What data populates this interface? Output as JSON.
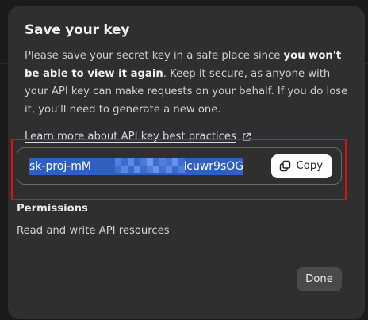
{
  "dialog": {
    "title": "Save your key",
    "description_part1": "Please save your secret key in a safe place since ",
    "description_bold": "you won't be able to view it again",
    "description_part2": ". Keep it secure, as anyone with your API key can make requests on your behalf. If you do lose it, you'll need to generate a new one.",
    "learn_more_link": "Learn more about API key best practices",
    "learn_more_icon": "external-link-icon",
    "api_key": {
      "prefix": "sk-proj-mM",
      "suffix": "bgNcuwr9sOG",
      "redacted": true
    },
    "copy_button": {
      "label": "Copy",
      "icon": "copy-icon"
    },
    "permissions": {
      "title": "Permissions",
      "value": "Read and write API resources"
    },
    "done_button": {
      "label": "Done"
    }
  },
  "colors": {
    "backdrop": "#1b1b1b",
    "dialog_bg": "#2f2f2f",
    "selection_highlight": "#2f5fc0",
    "annotation_border": "#e01010",
    "done_button_bg": "#4a4a4a"
  }
}
